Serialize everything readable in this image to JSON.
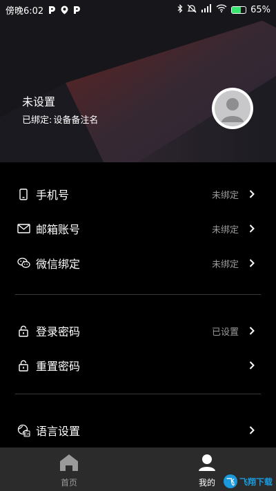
{
  "status_bar": {
    "time": "傍晚6:02",
    "notification_icons": [
      "P",
      "location-pin",
      "P"
    ],
    "battery_percent": 65,
    "battery_label": "65%",
    "icons": [
      "bluetooth-icon",
      "mute-icon",
      "signal-icon",
      "wifi-icon",
      "battery-icon"
    ]
  },
  "profile": {
    "name": "未设置",
    "bind_prefix": "已绑定:",
    "bind_value": "设备备注名"
  },
  "settings": {
    "group1": [
      {
        "key": "phone",
        "label": "手机号",
        "value": "未绑定",
        "icon": "phone-icon"
      },
      {
        "key": "email",
        "label": "邮箱账号",
        "value": "未绑定",
        "icon": "mail-icon"
      },
      {
        "key": "wechat",
        "label": "微信绑定",
        "value": "未绑定",
        "icon": "wechat-icon"
      }
    ],
    "group2": [
      {
        "key": "login_password",
        "label": "登录密码",
        "value": "已设置",
        "icon": "lock-icon"
      },
      {
        "key": "reset_password",
        "label": "重置密码",
        "value": "",
        "icon": "lock-icon"
      }
    ],
    "group3": [
      {
        "key": "language",
        "label": "语言设置",
        "value": "",
        "icon": "language-icon"
      }
    ]
  },
  "bottom_nav": {
    "home_label": "首页",
    "mine_label": "我的",
    "active": "mine"
  },
  "colors": {
    "background": "#000000",
    "nav_background": "#2b2b2b",
    "muted_text": "#9a9a9a",
    "battery_fill": "#39e36f"
  }
}
